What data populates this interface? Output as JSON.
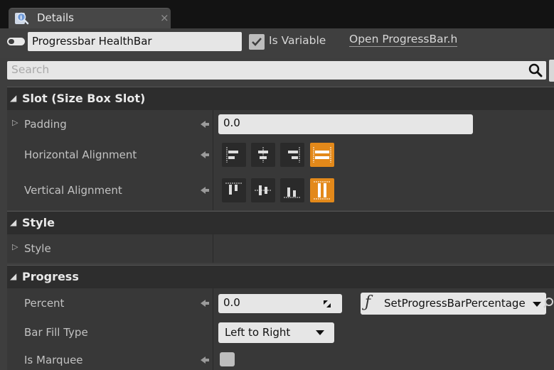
{
  "tab": {
    "title": "Details",
    "icon": "details-magnifier-icon",
    "close_glyph": "×"
  },
  "header": {
    "widget_name": "Progressbar HealthBar",
    "is_variable_label": "Is Variable",
    "is_variable_checked": true,
    "open_link": "Open ProgressBar.h"
  },
  "search": {
    "placeholder": "Search"
  },
  "sections": {
    "slot": {
      "title": "Slot (Size Box Slot)",
      "padding_label": "Padding",
      "padding_value": "0.0",
      "halign_label": "Horizontal Alignment",
      "valign_label": "Vertical Alignment",
      "halign_selected": "fill",
      "valign_selected": "fill"
    },
    "style": {
      "title": "Style",
      "style_label": "Style"
    },
    "progress": {
      "title": "Progress",
      "percent_label": "Percent",
      "percent_value": "0.0",
      "binding_function": "SetProgressBarPercentage",
      "bar_fill_type_label": "Bar Fill Type",
      "bar_fill_type_value": "Left to Right",
      "is_marquee_label": "Is Marquee",
      "is_marquee_checked": false
    }
  },
  "colors": {
    "accent_active": "#e3891a",
    "panel_bg": "#3e3e3e",
    "section_header_bg": "#2d2d2d",
    "field_bg": "#e6e6e6"
  }
}
